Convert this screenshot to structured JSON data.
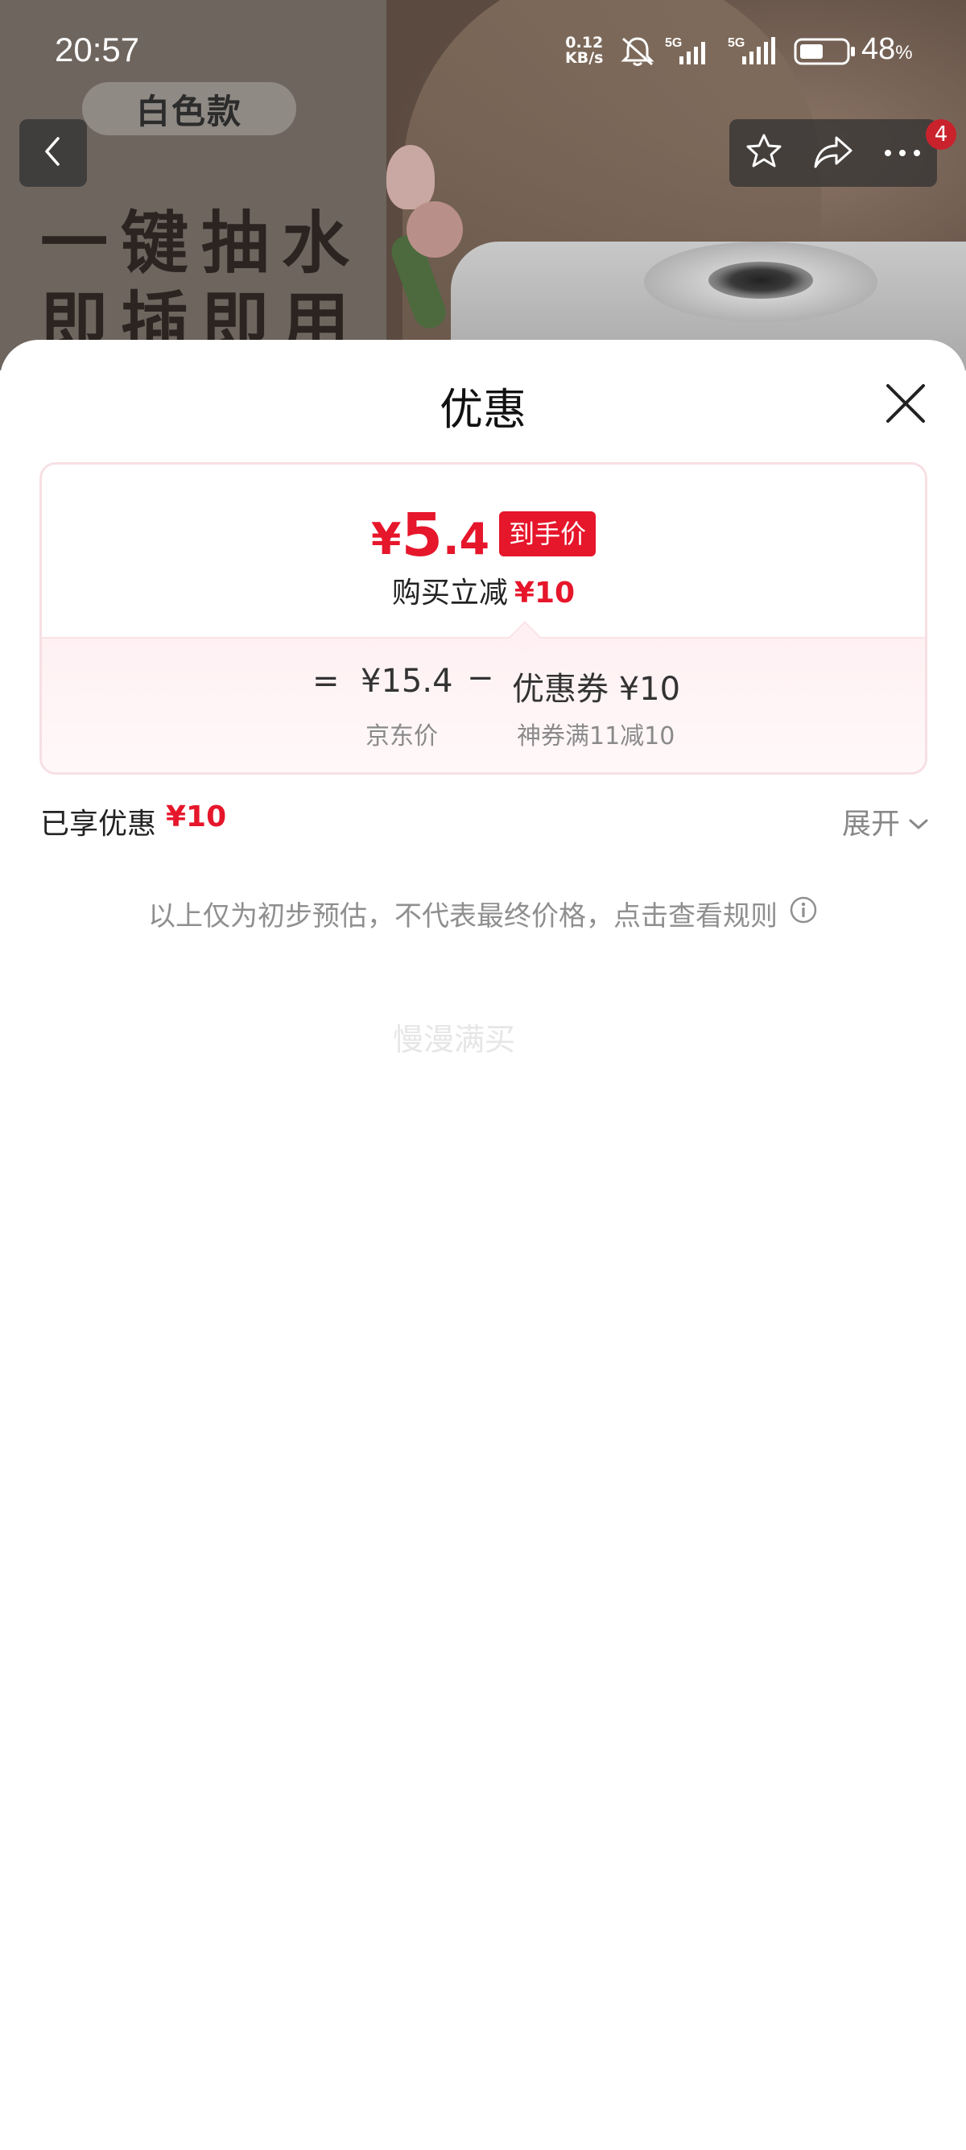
{
  "status_bar": {
    "time": "20:57",
    "net_speed_value": "0.12",
    "net_speed_unit": "KB/s",
    "signal1": "5G",
    "signal2": "5G",
    "battery_percent": "48",
    "battery_unit": "%"
  },
  "product": {
    "variant": "白色款",
    "slogan_line1": "一键抽水",
    "slogan_line2": "即插即用"
  },
  "nav": {
    "notification_count": "4"
  },
  "sheet": {
    "title": "优惠",
    "final_price": {
      "currency": "¥",
      "integer": "5",
      "decimal": ".4",
      "badge": "到手价"
    },
    "reduce": {
      "label": "购买立减",
      "amount": "¥10"
    },
    "formula": {
      "equals": "=",
      "jd_price": "¥15.4",
      "minus": "−",
      "coupon": "优惠券 ¥10",
      "jd_label": "京东价",
      "coupon_label": "神券满11减10"
    },
    "enjoyed": {
      "label": "已享优惠",
      "amount": "¥10",
      "expand": "展开"
    },
    "disclaimer": "以上仅为初步预估，不代表最终价格，点击查看规则",
    "watermark": "慢漫满买"
  },
  "colors": {
    "accent_red": "#e6162b",
    "card_border": "#f7dfe3"
  }
}
